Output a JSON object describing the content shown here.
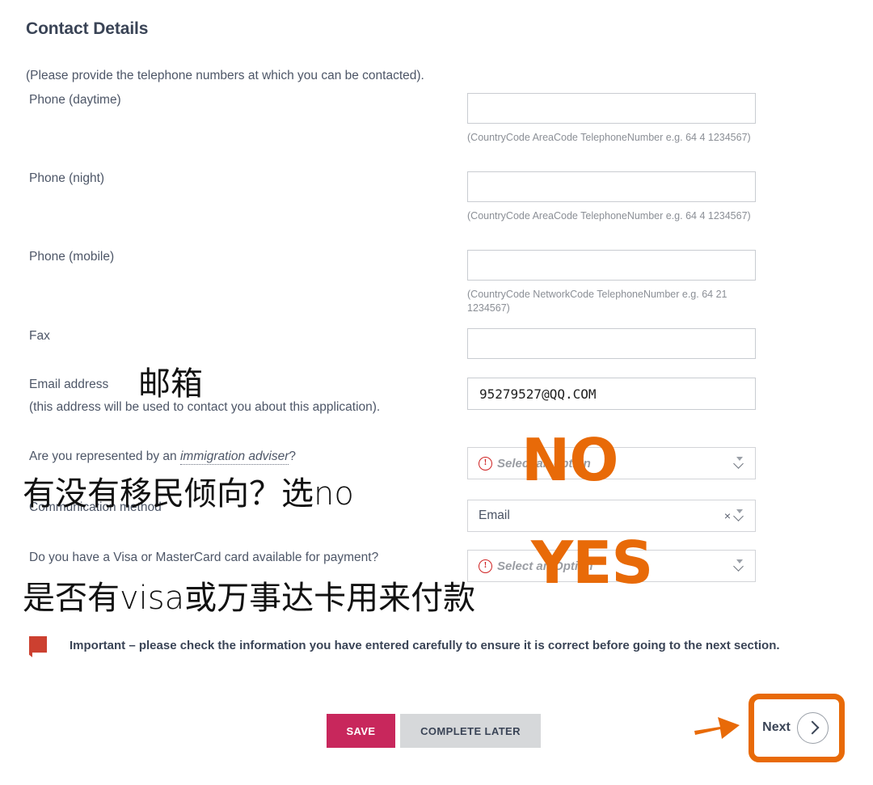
{
  "form": {
    "title": "Contact Details",
    "intro": "(Please provide the telephone numbers at which you can be contacted).",
    "phone_day": {
      "label": "Phone (daytime)",
      "value": "",
      "hint": "(CountryCode AreaCode TelephoneNumber e.g. 64 4 1234567)"
    },
    "phone_night": {
      "label": "Phone (night)",
      "value": "",
      "hint": "(CountryCode AreaCode TelephoneNumber e.g. 64 4 1234567)"
    },
    "phone_mobile": {
      "label": "Phone (mobile)",
      "value": "",
      "hint": "(CountryCode NetworkCode TelephoneNumber e.g. 64 21 1234567)"
    },
    "fax": {
      "label": "Fax",
      "value": ""
    },
    "email": {
      "label": "Email address",
      "sublabel": "(this address will be used to contact you about this application).",
      "value": "95279527@QQ.COM"
    },
    "adviser": {
      "label_before": "Are you represented by an ",
      "label_link": "immigration adviser",
      "label_after": "?",
      "placeholder": "Select an option",
      "error_icon": "error-exclamation-icon"
    },
    "communication": {
      "label": "Communication method",
      "value": "Email",
      "clear_icon": "clear-x-icon",
      "chevron_icon": "chevron-down-icon"
    },
    "payment_card": {
      "label": "Do you have a Visa or MasterCard card available for payment?",
      "placeholder": "Select an Option",
      "error_icon": "error-exclamation-icon"
    }
  },
  "notice": {
    "flag_icon": "red-flag-icon",
    "text": "Important – please check the information you have entered carefully to ensure it is correct before going to the next section."
  },
  "actions": {
    "save": "SAVE",
    "complete_later": "COMPLETE LATER",
    "next": "Next",
    "next_icon": "chevron-right-circle-icon"
  },
  "annotations": {
    "email_cn": "邮箱",
    "adviser_cn": "有没有移民倾向？选no",
    "payment_cn": "是否有visa或万事达卡用来付款",
    "adviser_answer": "NO",
    "payment_answer": "YES",
    "next_arrow_icon": "orange-arrow-right-icon",
    "highlight_color": "#e86a08"
  }
}
